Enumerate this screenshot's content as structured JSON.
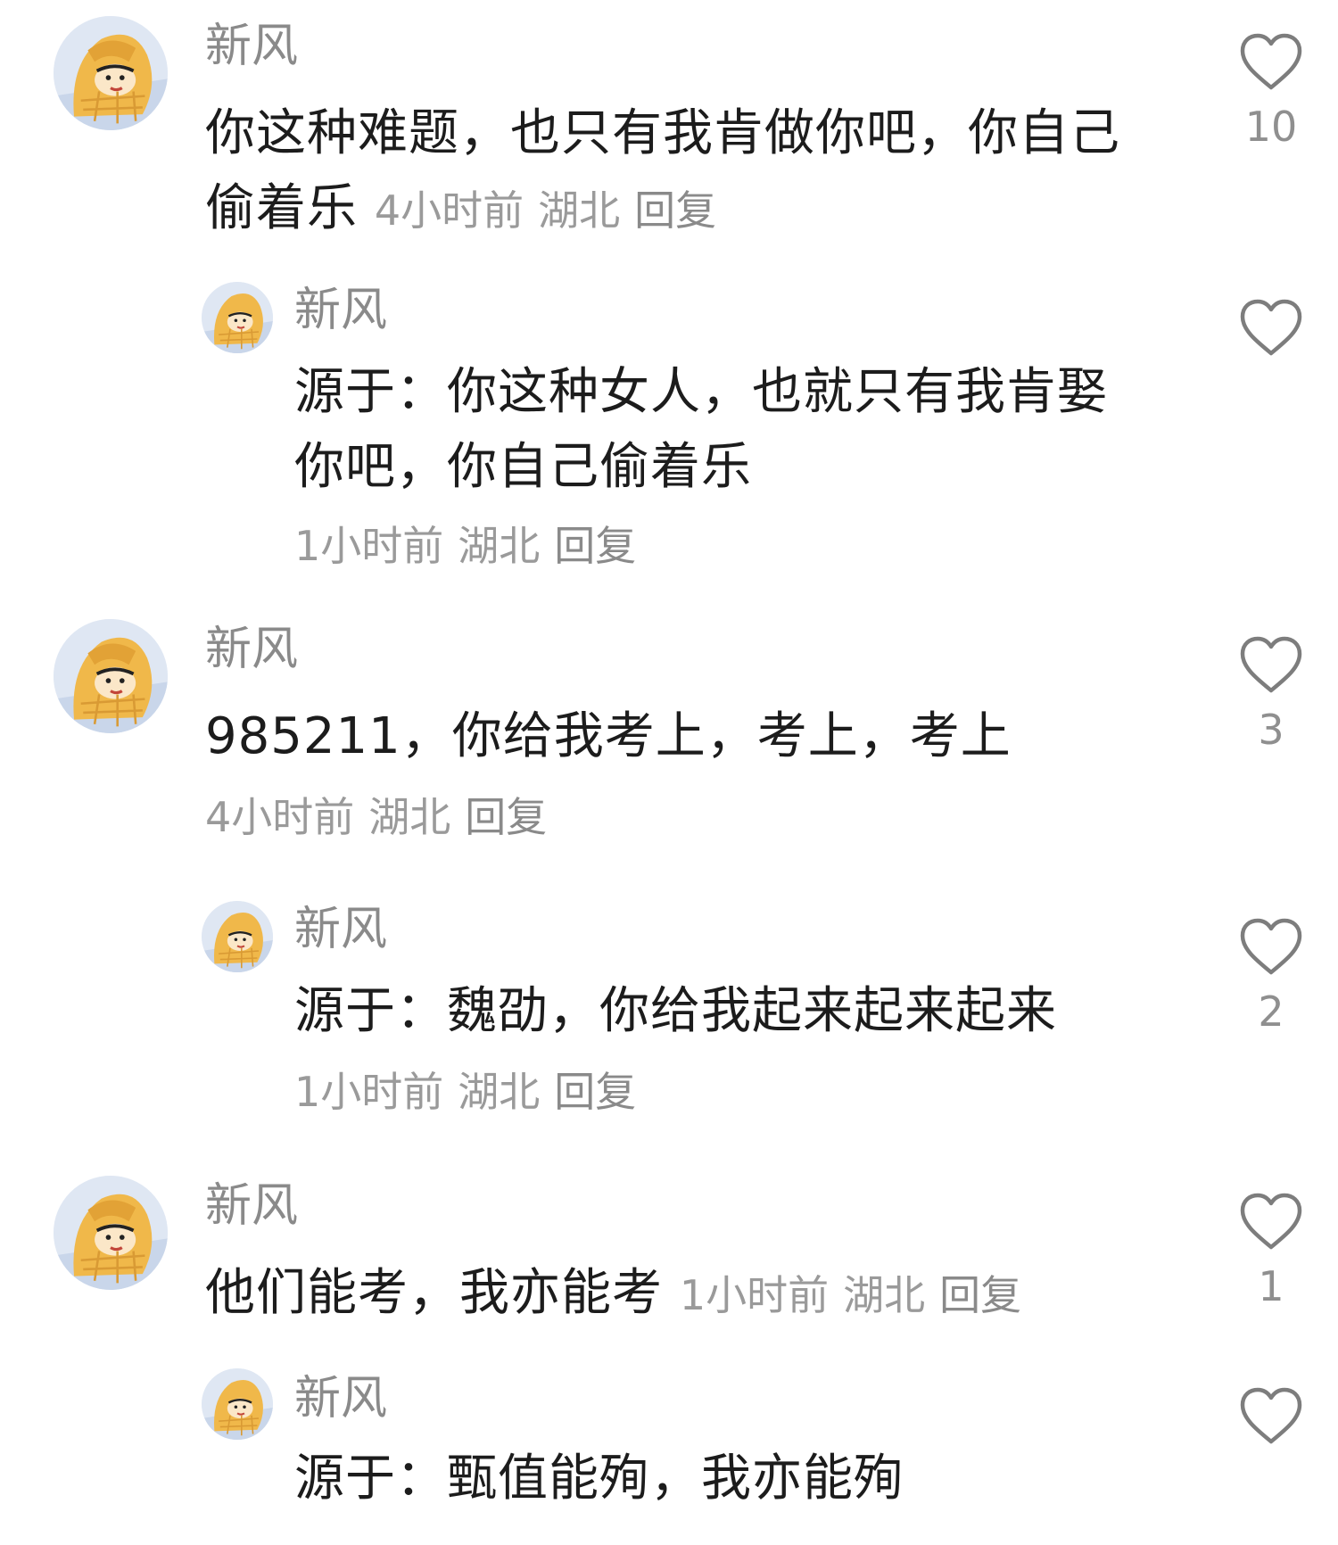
{
  "comments": [
    {
      "username": "新风",
      "text": "你这种难题，也只有我肯做你吧，你自己偷着乐",
      "time": "4小时前",
      "location": "湖北",
      "reply": "回复",
      "likes": "10"
    },
    {
      "username": "新风",
      "text": "源于：你这种女人，也就只有我肯娶你吧，你自己偷着乐",
      "time": "1小时前",
      "location": "湖北",
      "reply": "回复",
      "likes": ""
    },
    {
      "username": "新风",
      "text": "985211，你给我考上，考上，考上",
      "time": "4小时前",
      "location": "湖北",
      "reply": "回复",
      "likes": "3"
    },
    {
      "username": "新风",
      "text": "源于：魏劭，你给我起来起来起来",
      "time": "1小时前",
      "location": "湖北",
      "reply": "回复",
      "likes": "2"
    },
    {
      "username": "新风",
      "text": "他们能考，我亦能考",
      "time": "1小时前",
      "location": "湖北",
      "reply": "回复",
      "likes": "1"
    },
    {
      "username": "新风",
      "text": "源于：甄值能殉，我亦能殉",
      "likes": ""
    }
  ],
  "icons": {
    "avatar": "cartoon-avatar-icon",
    "like": "heart-outline-icon"
  },
  "colors": {
    "username": "#8a8a8a",
    "meta": "#9a9a9a",
    "text": "#1c1c1c",
    "heart": "#7d7d7d"
  }
}
